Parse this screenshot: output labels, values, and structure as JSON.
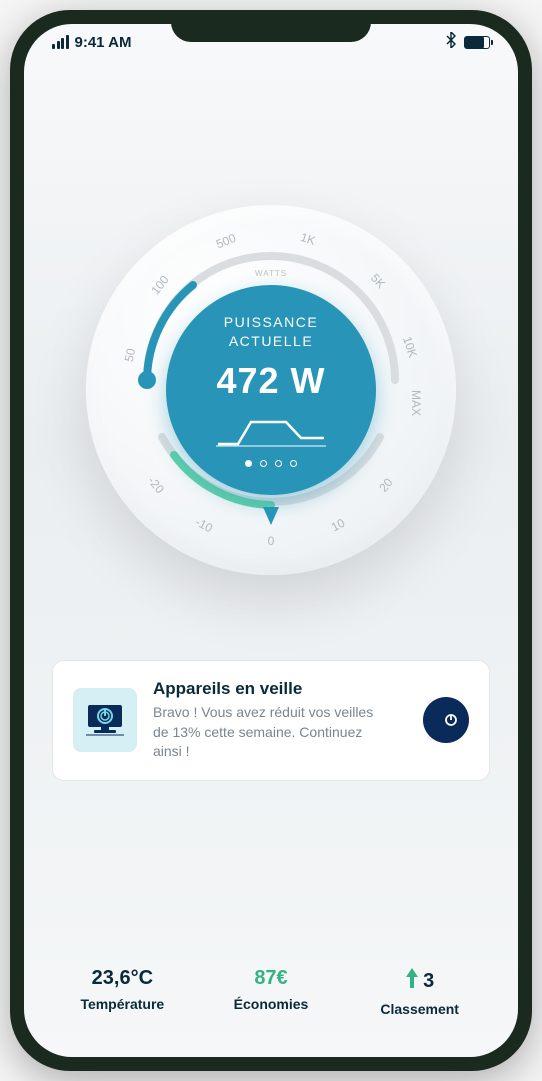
{
  "status_bar": {
    "time": "9:41 AM"
  },
  "dial": {
    "unit_label": "WATTS",
    "title_line1": "PUISSANCE",
    "title_line2": "ACTUELLE",
    "value": "472 W",
    "top_ticks": [
      "50",
      "100",
      "500",
      "1K",
      "5K",
      "10K",
      "MAX"
    ],
    "bottom_ticks": [
      "-20",
      "-10",
      "0",
      "10",
      "20"
    ]
  },
  "card": {
    "title": "Appareils en veille",
    "description": "Bravo !  Vous avez réduit vos veilles de 13% cette semaine. Continuez ainsi !"
  },
  "stats": {
    "temperature": {
      "value": "23,6°C",
      "label": "Température"
    },
    "savings": {
      "value": "87€",
      "label": "Économies"
    },
    "ranking": {
      "value": "3",
      "label": "Classement"
    }
  },
  "colors": {
    "primary": "#2895b8",
    "accent_green": "#33b383",
    "dark": "#0a2a3a"
  }
}
